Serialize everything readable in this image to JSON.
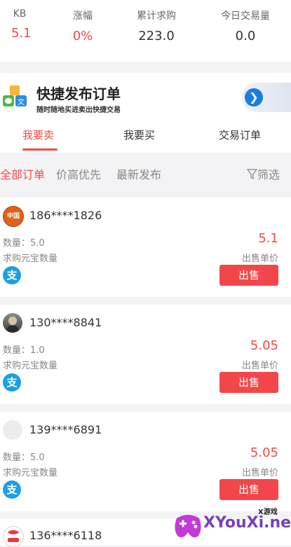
{
  "stats": [
    {
      "label": "KB",
      "value": "5.1",
      "color": "#f24a4a"
    },
    {
      "label": "涨幅",
      "value": "0%",
      "color": "#f24a4a"
    },
    {
      "label": "累计求购",
      "value": "223.0",
      "color": "#333333"
    },
    {
      "label": "今日交易量",
      "value": "0.0",
      "color": "#333333"
    }
  ],
  "banner": {
    "title": "快捷发布订单",
    "subtitle": "随时随地买进卖出快捷交易",
    "icon": "app-blocks-icon",
    "go_icon": "arrow-right-icon"
  },
  "tabs": [
    {
      "label": "我要卖",
      "active": true
    },
    {
      "label": "我要买",
      "active": false
    },
    {
      "label": "交易订单",
      "active": false
    }
  ],
  "filters": {
    "items": [
      "全部订单",
      "价高优先",
      "最新发布"
    ],
    "active": "全部订单",
    "filter_label": "筛选",
    "filter_icon": "funnel-icon"
  },
  "orders": [
    {
      "user": "186****1826",
      "quantity": "数量：5.0",
      "quantity_label": "求购元宝数量",
      "price": "5.1",
      "price_label": "出售单价",
      "button": "出售",
      "pay_icon": "支",
      "avatar_text": "中国"
    },
    {
      "user": "130****8841",
      "quantity": "数量：1.0",
      "quantity_label": "求购元宝数量",
      "price": "5.05",
      "price_label": "出售单价",
      "button": "出售",
      "pay_icon": "支"
    },
    {
      "user": "139****6891",
      "quantity": "数量：5.0",
      "quantity_label": "求购元宝数量",
      "price": "5.05",
      "price_label": "出售单价",
      "button": "出售",
      "pay_icon": "支"
    },
    {
      "user": "136****6118"
    }
  ],
  "watermark": {
    "brand": "XYouXi.net",
    "tag": "X游戏"
  },
  "colors": {
    "accent": "#f24a4a",
    "pay": "#1a9fe6",
    "go": "#1c7ce0"
  }
}
